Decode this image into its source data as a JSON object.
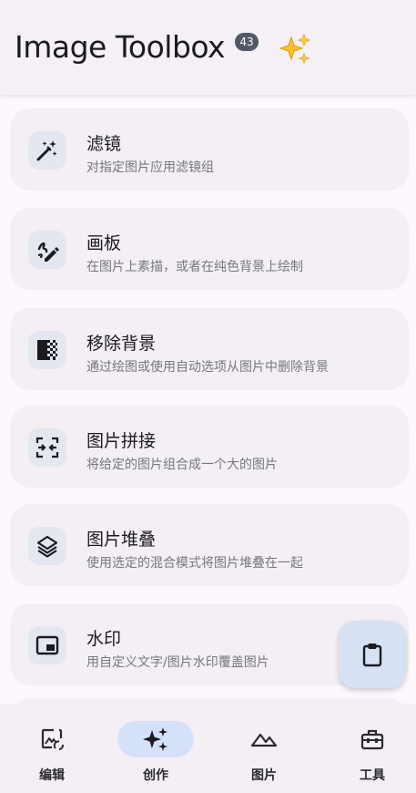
{
  "app": {
    "title": "Image Toolbox",
    "version_badge": "43",
    "sparkle_icon": "sparkles-icon"
  },
  "colors": {
    "background": "#fcf8fd",
    "card": "#f3eff5",
    "icon_container": "#e4e6f0",
    "active_nav": "#d5e1f8",
    "fab": "#d6e1f4",
    "badge": "#505964"
  },
  "tools": [
    {
      "title": "滤镜",
      "subtitle": "对指定图片应用滤镜组",
      "icon": "magic-wand-icon"
    },
    {
      "title": "画板",
      "subtitle": "在图片上素描，或者在纯色背景上绘制",
      "icon": "draw-icon"
    },
    {
      "title": "移除背景",
      "subtitle": "通过绘图或使用自动选项从图片中删除背景",
      "icon": "transparency-icon"
    },
    {
      "title": "图片拼接",
      "subtitle": "将给定的图片组合成一个大的图片",
      "icon": "stitch-icon"
    },
    {
      "title": "图片堆叠",
      "subtitle": "使用选定的混合模式将图片堆叠在一起",
      "icon": "layers-icon"
    },
    {
      "title": "水印",
      "subtitle": "用自定义文字/图片水印覆盖图片",
      "icon": "picture-in-picture-icon"
    }
  ],
  "fab": {
    "icon": "clipboard-icon"
  },
  "nav": [
    {
      "label": "编辑",
      "icon": "image-edit-icon",
      "active": false
    },
    {
      "label": "创作",
      "icon": "sparkles-icon",
      "active": true
    },
    {
      "label": "图片",
      "icon": "landscape-icon",
      "active": false
    },
    {
      "label": "工具",
      "icon": "toolbox-icon",
      "active": false
    }
  ]
}
